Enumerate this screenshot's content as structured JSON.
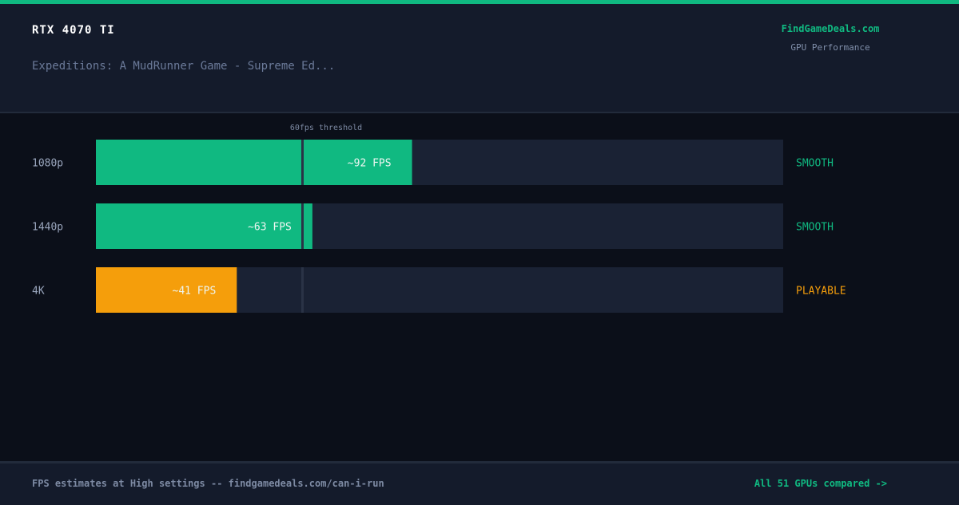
{
  "header": {
    "gpu_name": "RTX 4070 TI",
    "game_title": "Expeditions: A MudRunner Game - Supreme Ed...",
    "brand": "FindGameDeals.com",
    "brand_subtitle": "GPU Performance"
  },
  "footer": {
    "note": "FPS estimates at High settings -- findgamedeals.com/can-i-run",
    "link": "All 51 GPUs compared ->"
  },
  "colors": {
    "smooth": "#10b981",
    "playable": "#f59e0b",
    "track": "#1a2234",
    "threshold_line": "#2a3346",
    "accent": "#10b981"
  },
  "chart_data": {
    "type": "bar",
    "orientation": "horizontal",
    "categories": [
      "1080p",
      "1440p",
      "4K"
    ],
    "values": [
      92,
      63,
      41
    ],
    "value_labels": [
      "~92 FPS",
      "~63 FPS",
      "~41 FPS"
    ],
    "ratings": [
      "SMOOTH",
      "SMOOTH",
      "PLAYABLE"
    ],
    "xlim": [
      0,
      200
    ],
    "threshold": {
      "value": 60,
      "label": "60fps threshold"
    }
  }
}
